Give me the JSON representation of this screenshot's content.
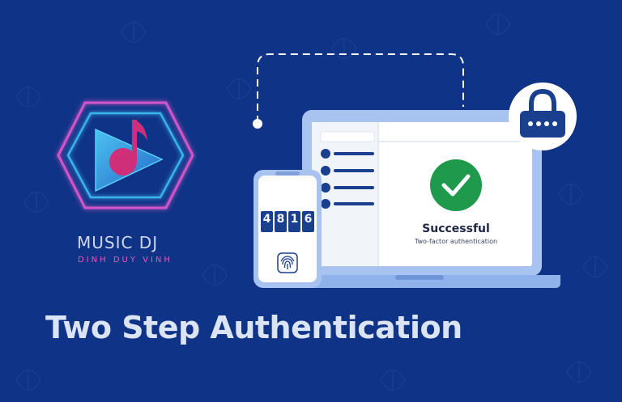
{
  "logo": {
    "title": "MUSIC DJ",
    "subtitle": "DINH DUY VINH",
    "icon": "music-play-icon"
  },
  "laptop": {
    "status_title": "Successful",
    "status_subtitle": "Two-factor authentication",
    "status_icon": "checkmark-icon"
  },
  "phone": {
    "code_digits": [
      "4",
      "8",
      "1",
      "6"
    ],
    "biometric_icon": "fingerprint-icon"
  },
  "badge": {
    "icon": "lock-icon"
  },
  "headline": "Two Step Authentication",
  "colors": {
    "background": "#0f3386",
    "accent_green": "#1f9a4c",
    "neon_pink": "#e25bb3",
    "neon_blue": "#36b3e9"
  }
}
